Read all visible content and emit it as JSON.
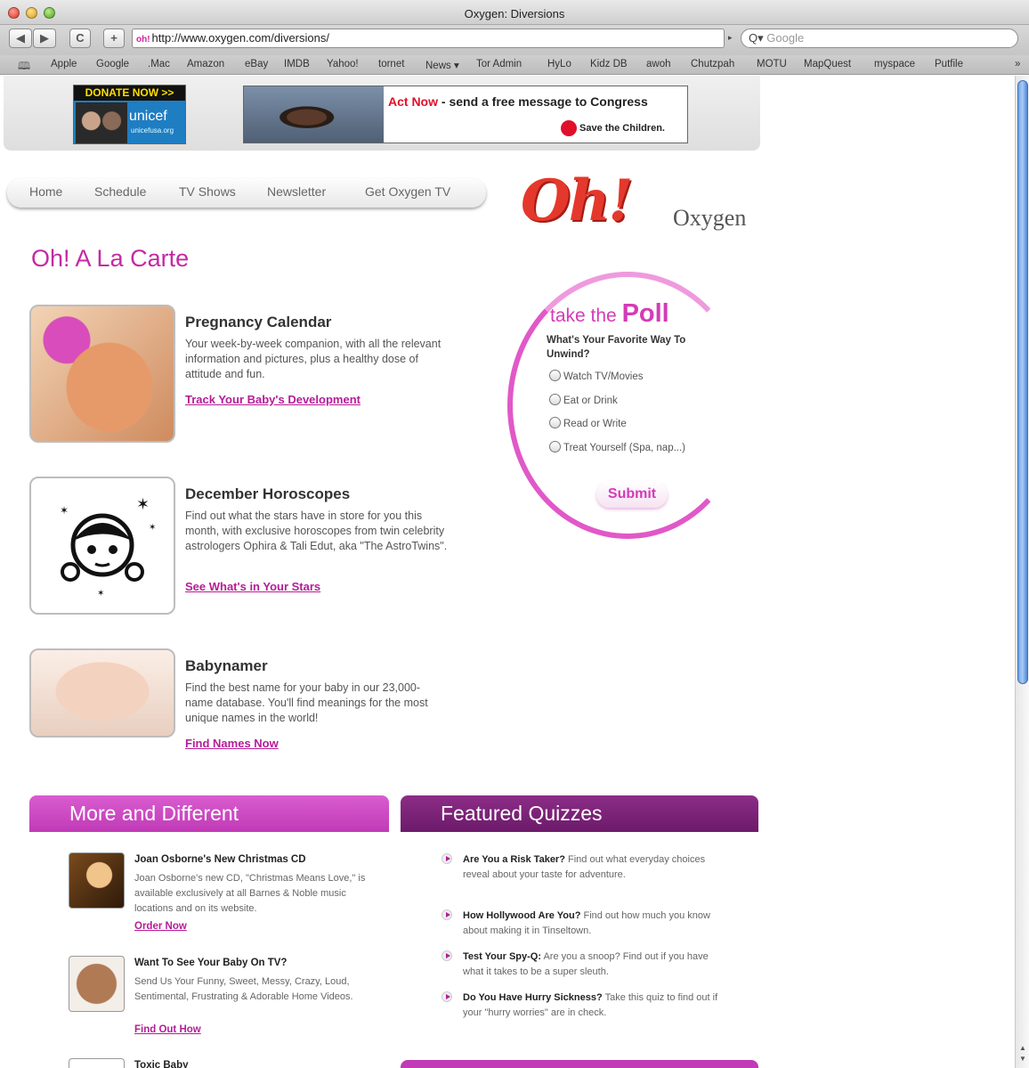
{
  "window": {
    "title": "Oxygen: Diversions"
  },
  "toolbar": {
    "back": "◀",
    "forward": "▶",
    "reload": "C",
    "add": "+",
    "favicon": "oh!",
    "url": "http://www.oxygen.com/diversions/",
    "search_placeholder": "Google"
  },
  "bookmarks": [
    "Apple",
    "Google",
    ".Mac",
    "Amazon",
    "eBay",
    "IMDB",
    "Yahoo!",
    "tornet",
    "News ▾",
    "Tor Admin",
    "HyLo",
    "Kidz DB",
    "awoh",
    "Chutzpah",
    "MOTU",
    "MapQuest",
    "myspace",
    "Putfile"
  ],
  "bookmarks_more": "»",
  "ads": {
    "unicef_donate": "DONATE NOW >>",
    "unicef_logo": "unicef",
    "unicef_url": "unicefusa.org",
    "stc_act": "Act Now",
    "stc_message": " - send a free message to Congress",
    "stc_logo": "Save the Children."
  },
  "nav": [
    "Home",
    "Schedule",
    "TV Shows",
    "Newsletter",
    "Get Oxygen TV"
  ],
  "logo": {
    "oh": "Oh!",
    "brand": "Oxygen"
  },
  "page_title": "Oh! A La Carte",
  "features": [
    {
      "title": "Pregnancy Calendar",
      "desc": "Your week-by-week companion, with all the relevant information and pictures, plus a healthy dose of attitude and fun.",
      "link": "Track Your Baby's Development"
    },
    {
      "title": "December Horoscopes",
      "desc": "Find out what the stars have in store for you this month, with exclusive horoscopes from twin celebrity astrologers Ophira & Tali Edut, aka \"The AstroTwins\".",
      "link": "See What's in Your Stars"
    },
    {
      "title": "Babynamer",
      "desc": "Find the best name for your baby in our 23,000-name database. You'll find meanings for the most unique names in the world!",
      "link": "Find Names Now"
    }
  ],
  "poll": {
    "title_pre": "take the ",
    "title_bold": "Poll",
    "question": "What's Your Favorite Way To Unwind?",
    "options": [
      "Watch TV/Movies",
      "Eat or Drink",
      "Read or Write",
      "Treat Yourself (Spa, nap...)"
    ],
    "submit": "Submit"
  },
  "more": {
    "header": "More and Different",
    "items": [
      {
        "title": "Joan Osborne's New Christmas CD",
        "desc": "Joan Osborne's new CD, \"Christmas Means Love,\" is available exclusively at all Barnes & Noble music locations and on its website.",
        "link": "Order Now"
      },
      {
        "title": "Want To See Your Baby On TV?",
        "desc": "Send Us Your Funny, Sweet, Messy, Crazy, Loud, Sentimental, Frustrating & Adorable Home Videos.",
        "link": "Find Out How"
      }
    ],
    "next_partial": "Toxic Baby"
  },
  "quizzes": {
    "header": "Featured Quizzes",
    "items": [
      {
        "title": "Are You a Risk Taker?",
        "desc": " Find out what everyday choices reveal about your taste for adventure."
      },
      {
        "title": "How Hollywood Are You?",
        "desc": " Find out how much you know about making it in Tinseltown."
      },
      {
        "title": "Test Your Spy-Q:",
        "desc": " Are you a snoop? Find out if you have what it takes to be a super sleuth."
      },
      {
        "title": "Do You Have Hurry Sickness?",
        "desc": " Take this quiz to find out if your \"hurry worries\" are in check."
      }
    ]
  }
}
